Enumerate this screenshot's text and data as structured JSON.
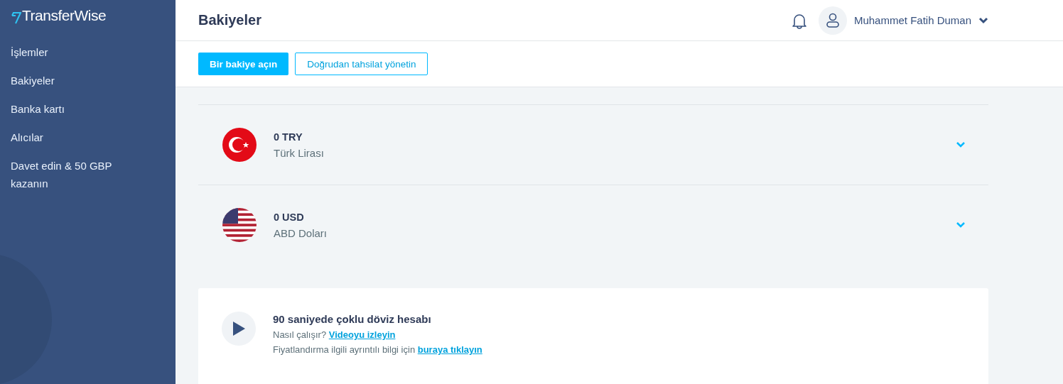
{
  "brand": {
    "name": "TransferWise"
  },
  "sidebar": {
    "items": [
      {
        "label": "İşlemler"
      },
      {
        "label": "Bakiyeler"
      },
      {
        "label": "Banka kartı"
      },
      {
        "label": "Alıcılar"
      },
      {
        "label": "Davet edin & 50 GBP kazanın"
      }
    ]
  },
  "header": {
    "title": "Bakiyeler",
    "user": "Muhammet Fatih Duman"
  },
  "toolbar": {
    "primary": "Bir bakiye açın",
    "secondary": "Doğrudan tahsilat yönetin"
  },
  "balances": [
    {
      "kind": "tr",
      "amount": "0 TRY",
      "currency": "Türk Lirası"
    },
    {
      "kind": "us",
      "amount": "0 USD",
      "currency": "ABD Doları"
    }
  ],
  "promo": {
    "title": "90 saniyede çoklu döviz hesabı",
    "lines": [
      {
        "text": "Nasıl çalışır?",
        "link": "Videoyu izleyin"
      },
      {
        "text": "Fiyatlandırma ilgili ayrıntılı bilgi için",
        "link": "buraya tıklayın"
      }
    ]
  }
}
